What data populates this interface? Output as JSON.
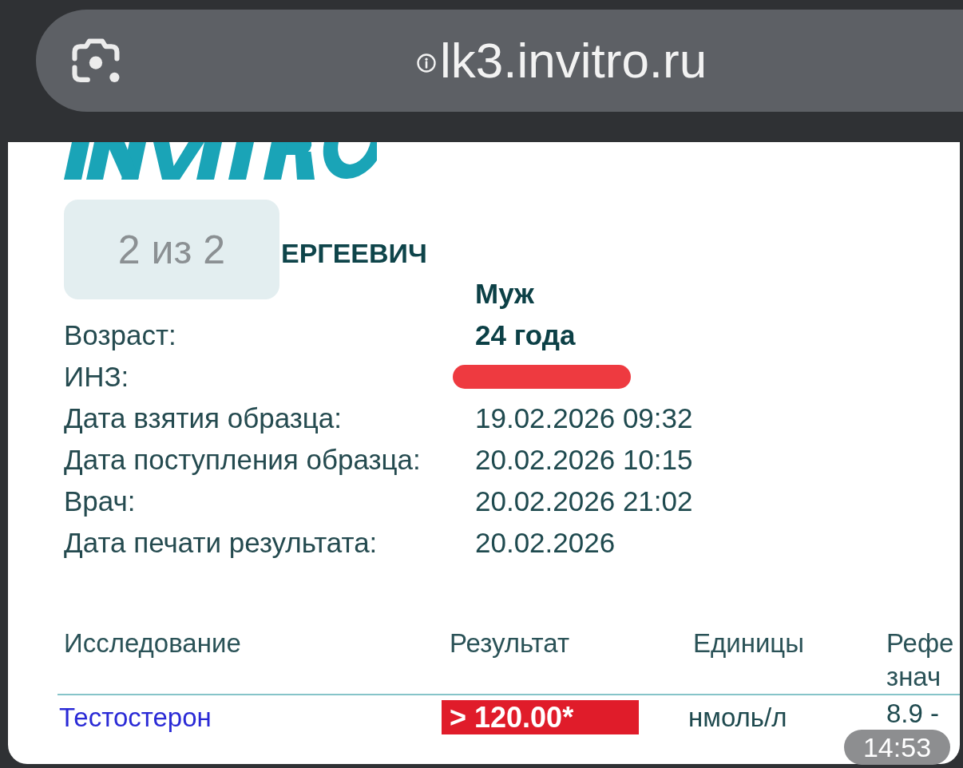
{
  "browser": {
    "address": "lk3.invitro.ru"
  },
  "page_counter": "2 из 2",
  "report": {
    "patient_name": "ЕРГЕЕВИЧ",
    "fields": [
      {
        "value": "Муж",
        "bold": true,
        "redacted": false
      },
      {
        "label": "Возраст:",
        "value": "24 года",
        "bold": true,
        "redacted": false
      },
      {
        "label": "ИНЗ:",
        "redacted": true
      },
      {
        "label": "Дата взятия образца:",
        "value": "19.02.2026 09:32",
        "bold": false,
        "redacted": false
      },
      {
        "label": "Дата поступления образца:",
        "value": "20.02.2026 10:15",
        "bold": false,
        "redacted": false
      },
      {
        "label": "Врач:",
        "value": "20.02.2026 21:02",
        "bold": false,
        "redacted": false
      },
      {
        "label": "Дата печати результата:",
        "value": "20.02.2026",
        "bold": false,
        "redacted": false
      }
    ]
  },
  "table": {
    "columns": [
      {
        "lines": [
          "Исследование"
        ]
      },
      {
        "lines": [
          "Результат"
        ]
      },
      {
        "lines": [
          "Единицы"
        ]
      },
      {
        "lines": [
          "Рефе",
          "знач"
        ]
      }
    ],
    "rows": [
      {
        "test": "Тестостерон",
        "result": "> 120.00*",
        "flagged": true,
        "units": "нмоль/л",
        "reference": "8.9 -"
      }
    ]
  },
  "timestamp": "14:53"
}
